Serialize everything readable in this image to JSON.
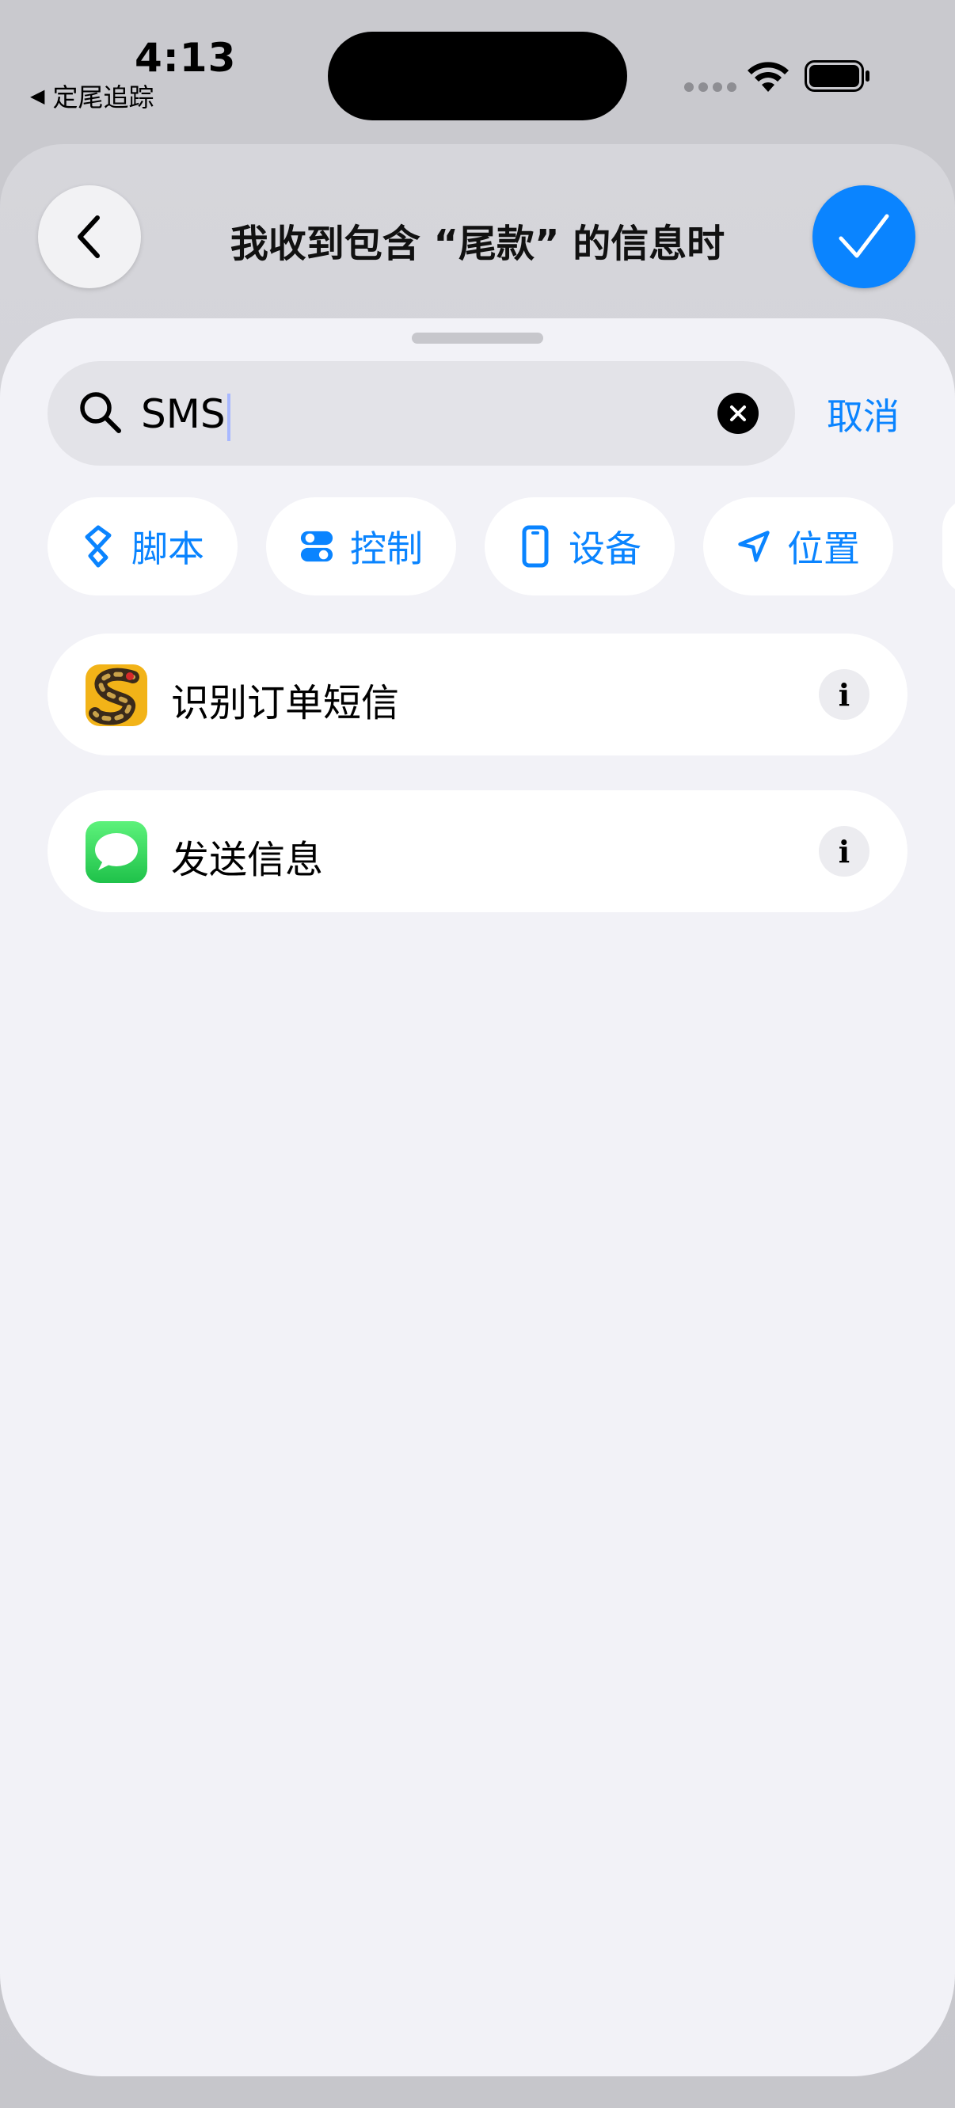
{
  "status": {
    "time": "4:13",
    "back_app": "定尾追踪"
  },
  "nav": {
    "title": "我收到包含 “尾款” 的信息时"
  },
  "search": {
    "value": "SMS",
    "cancel_label": "取消"
  },
  "chips": [
    {
      "label": "脚本",
      "icon": "script-icon"
    },
    {
      "label": "控制",
      "icon": "toggle-icon"
    },
    {
      "label": "设备",
      "icon": "phone-icon"
    },
    {
      "label": "位置",
      "icon": "location-arrow-icon"
    }
  ],
  "results": [
    {
      "label": "识别订单短信",
      "icon": "snake-app-icon"
    },
    {
      "label": "发送信息",
      "icon": "messages-app-icon"
    }
  ],
  "colors": {
    "accent": "#0a84ff",
    "sheet_bg": "#f2f2f7",
    "messages_green": "#34c759"
  }
}
